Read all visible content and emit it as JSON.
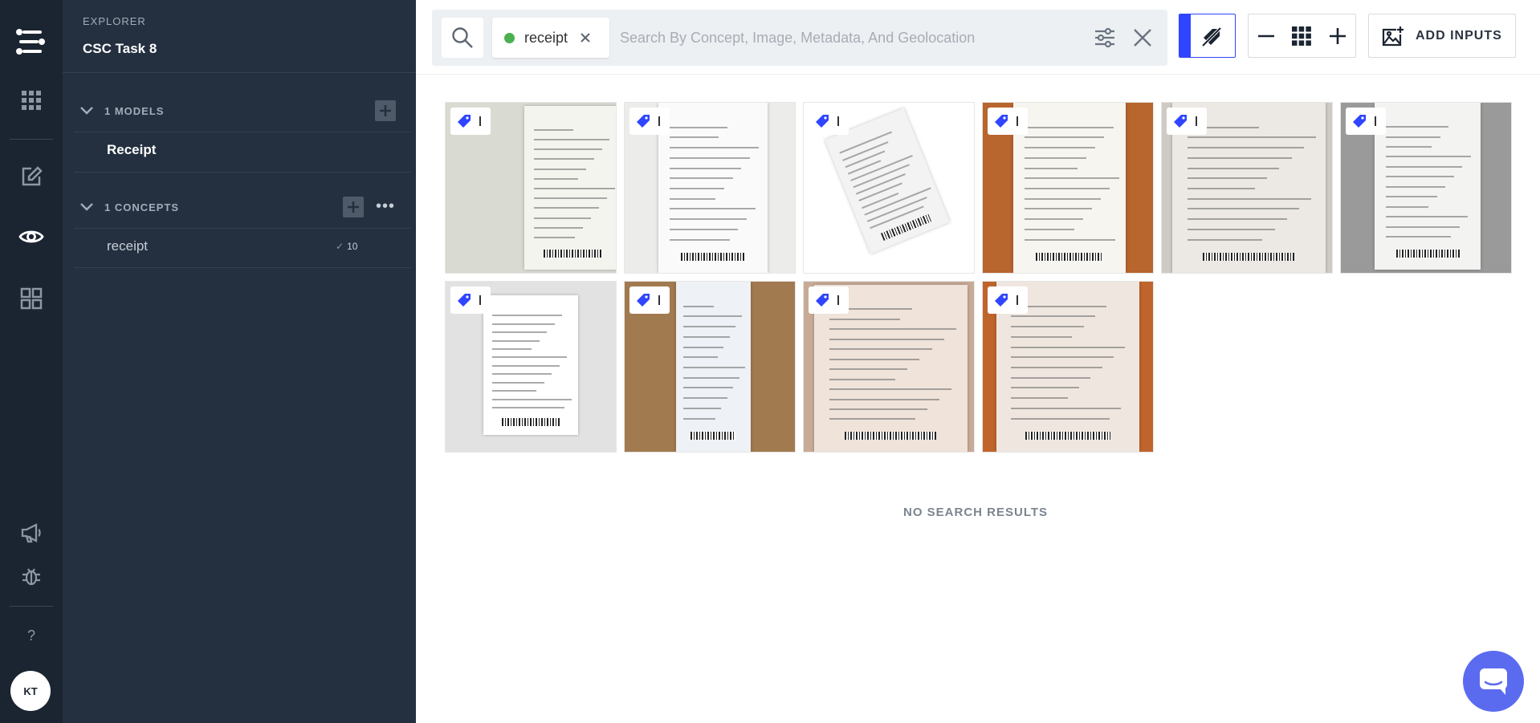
{
  "rail": {
    "items": [
      {
        "name": "apps-grid-icon"
      },
      {
        "name": "edit-icon"
      },
      {
        "name": "eye-icon"
      },
      {
        "name": "dashboard-icon"
      }
    ],
    "help_label": "?",
    "avatar_initials": "KT",
    "accent": "#1b2431"
  },
  "explorer": {
    "label": "EXPLORER",
    "app_name": "CSC Task 8",
    "models_section": "1 MODELS",
    "models": [
      {
        "label": "Receipt"
      }
    ],
    "concepts_section": "1 CONCEPTS",
    "concepts": [
      {
        "label": "receipt",
        "count": "10"
      }
    ]
  },
  "search": {
    "chip_label": "receipt",
    "chip_status_color": "#4caf50",
    "placeholder": "Search By Concept, Image, Metadata, And Geolocation",
    "value": ""
  },
  "toolbar": {
    "add_inputs_label": "ADD INPUTS",
    "accent_color": "#2f45ff"
  },
  "results": {
    "thumbnails": [
      {
        "name": "thumb-walmart",
        "bg": "#d9dbd2",
        "paper": "#f4f4ef"
      },
      {
        "name": "thumb-receipt-2",
        "bg": "#ececea",
        "paper": "#fafafa"
      },
      {
        "name": "thumb-shopping-store",
        "bg": "#ffffff",
        "paper": "#f3f3f3"
      },
      {
        "name": "thumb-berghotel",
        "bg": "#b8652e",
        "paper": "#f7f5f0"
      },
      {
        "name": "thumb-sweetgreen",
        "bg": "#cfcac5",
        "paper": "#ece8e3"
      },
      {
        "name": "thumb-cash-receipt",
        "bg": "#9a9a9a",
        "paper": "#f3f3f1"
      },
      {
        "name": "thumb-shop-name",
        "bg": "#e2e2e2",
        "paper": "#ffffff"
      },
      {
        "name": "thumb-main-street",
        "bg": "#a27a4f",
        "paper": "#eef1f5"
      },
      {
        "name": "thumb-strong-flour",
        "bg": "#c8ab97",
        "paper": "#efe3da"
      },
      {
        "name": "thumb-kvs-order",
        "bg": "#c0642d",
        "paper": "#efe7df"
      }
    ],
    "empty_message": "NO SEARCH RESULTS"
  }
}
